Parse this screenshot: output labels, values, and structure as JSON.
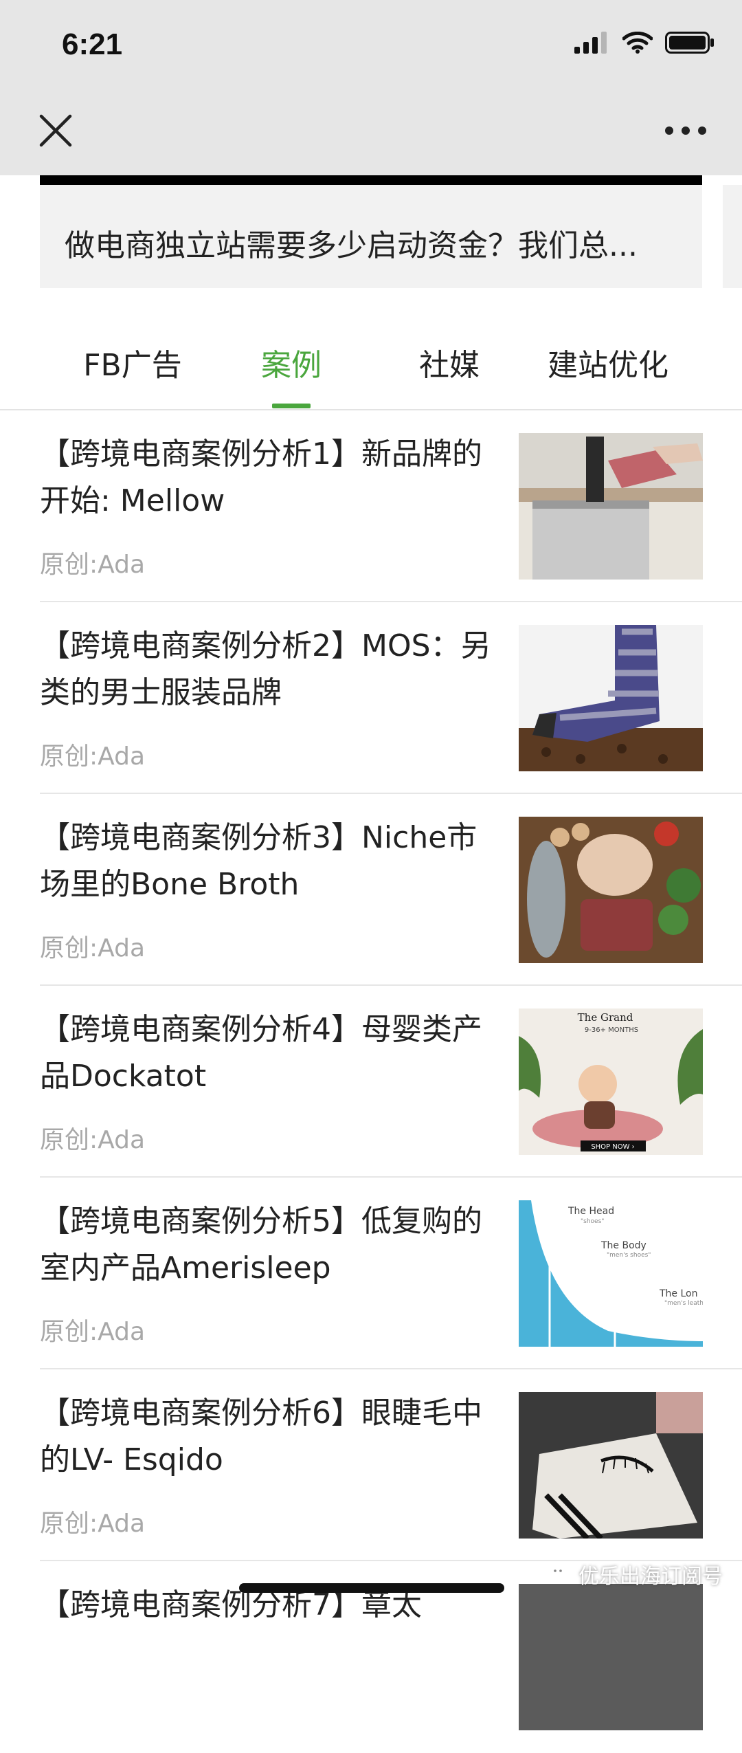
{
  "status_bar": {
    "time": "6:21"
  },
  "banner": {
    "title": "做电商独立站需要多少启动资金？我们总..."
  },
  "tabs": [
    {
      "label": "FB广告",
      "active": false
    },
    {
      "label": "案例",
      "active": true
    },
    {
      "label": "社媒",
      "active": false
    },
    {
      "label": "建站优化",
      "active": false
    }
  ],
  "articles": [
    {
      "title": "【跨境电商案例分析1】新品牌的开始: Mellow",
      "source": "原创:Ada"
    },
    {
      "title": "【跨境电商案例分析2】MOS：另类的男士服装品牌",
      "source": "原创:Ada"
    },
    {
      "title": "【跨境电商案例分析3】Niche市场里的Bone Broth",
      "source": "原创:Ada"
    },
    {
      "title": "【跨境电商案例分析4】母婴类产品Dockatot",
      "source": "原创:Ada"
    },
    {
      "title": "【跨境电商案例分析5】低复购的室内产品Amerisleep",
      "source": "原创:Ada"
    },
    {
      "title": "【跨境电商案例分析6】眼睫毛中的LV- Esqido",
      "source": "原创:Ada"
    },
    {
      "title": "【跨境电商案例分析7】章太",
      "source": ""
    }
  ],
  "thumb_text": {
    "t4_heading": "The Grand",
    "t4_sub": "9-36+ MONTHS",
    "t4_cta": "SHOP NOW ›",
    "t5_head": "The Head",
    "t5_head_sub": "\"shoes\"",
    "t5_body": "The Body",
    "t5_body_sub": "\"men's shoes\"",
    "t5_long": "The Lon",
    "t5_long_sub": "\"men's leathe"
  },
  "watermark": {
    "text": "优乐出海订阅号"
  },
  "colors": {
    "accent": "#4aa63d",
    "nav_bg": "#e6e6e6",
    "meta_text": "#a8a8a8"
  }
}
